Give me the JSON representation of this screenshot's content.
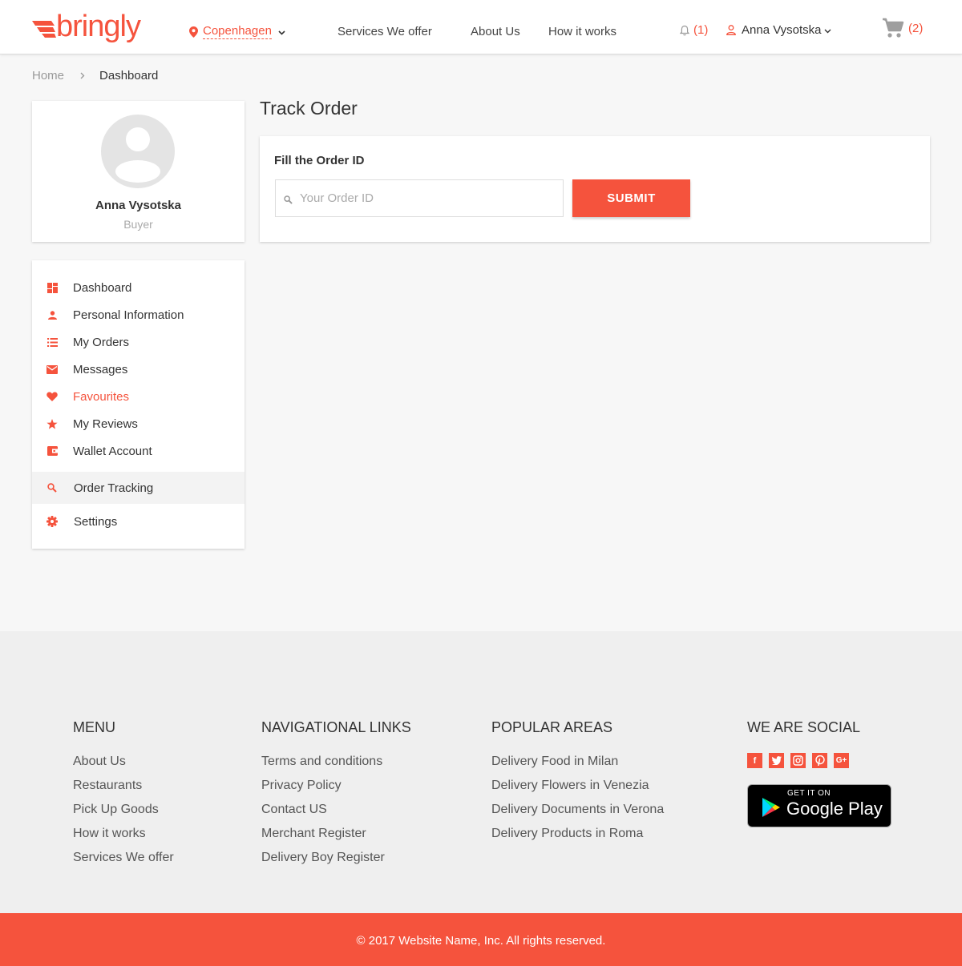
{
  "header": {
    "logo_text": "bringly",
    "location": "Copenhagen",
    "nav": [
      "Services  We offer",
      "About Us",
      "How it works"
    ],
    "notifications": "(1)",
    "user_name": "Anna Vysotska",
    "cart_count": "(2)"
  },
  "breadcrumb": {
    "home": "Home",
    "current": "Dashboard"
  },
  "profile": {
    "name": "Anna Vysotska",
    "role": "Buyer"
  },
  "sidebar": {
    "items": [
      {
        "label": "Dashboard",
        "icon": "dashboard-icon"
      },
      {
        "label": "Personal Information",
        "icon": "person-icon"
      },
      {
        "label": "My Orders",
        "icon": "list-icon"
      },
      {
        "label": "Messages",
        "icon": "mail-icon"
      },
      {
        "label": "Favourites",
        "icon": "heart-icon"
      },
      {
        "label": "My Reviews",
        "icon": "star-icon"
      },
      {
        "label": "Wallet Account",
        "icon": "wallet-icon"
      },
      {
        "label": "Order Tracking",
        "icon": "search-icon"
      },
      {
        "label": "Settings",
        "icon": "gear-icon"
      }
    ]
  },
  "main": {
    "title": "Track Order",
    "form_label": "Fill the Order ID",
    "input_placeholder": "Your Order ID",
    "input_value": "",
    "submit_label": "SUBMIT"
  },
  "footer": {
    "menu": {
      "heading": "MENU",
      "links": [
        "About Us",
        "Restaurants",
        "Pick Up Goods",
        "How it works",
        "Services We offer"
      ]
    },
    "nav_links": {
      "heading": "NAVIGATIONAL LINKS",
      "links": [
        "Terms and conditions",
        "Privacy Policy",
        "Contact US",
        "Merchant Register",
        "Delivery Boy Register"
      ]
    },
    "popular": {
      "heading": "POPULAR AREAS",
      "links": [
        "Delivery Food in Milan",
        "Delivery Flowers in Venezia",
        "Delivery Documents in Verona",
        "Delivery Products in Roma"
      ]
    },
    "social": {
      "heading": "WE ARE SOCIAL",
      "icons": [
        "facebook-icon",
        "twitter-icon",
        "instagram-icon",
        "pinterest-icon",
        "google-plus-icon"
      ]
    },
    "google_play": {
      "small": "GET IT ON",
      "big": "Google Play"
    },
    "copyright": "© 2017 Website Name, Inc. All rights reserved."
  },
  "colors": {
    "accent": "#f5533d",
    "page_bg": "#f7f7f7",
    "footer_bg": "#efefef"
  }
}
